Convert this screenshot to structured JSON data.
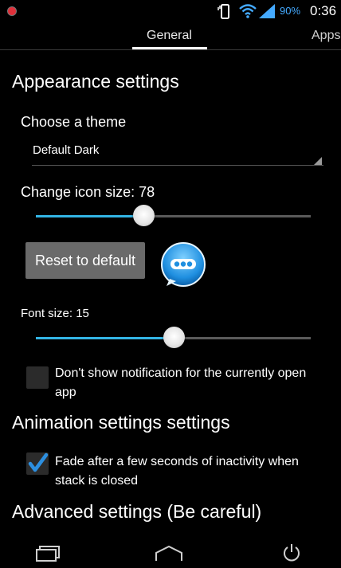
{
  "status_bar": {
    "battery_percent": "90%",
    "time": "0:36",
    "icons": [
      "record-indicator-icon",
      "phone-vibrate-icon",
      "wifi-icon",
      "signal-icon"
    ]
  },
  "tabs": [
    {
      "label": "General",
      "selected": true
    },
    {
      "label": "Apps",
      "selected": false
    }
  ],
  "appearance": {
    "title": "Appearance settings",
    "theme_label": "Choose a theme",
    "theme_value": "Default Dark",
    "icon_size_label": "Change icon size: 78",
    "icon_size_level": 0.39,
    "reset_button": "Reset to default",
    "font_size_label": "Font size: 15",
    "font_size_level": 0.5,
    "hide_notification": {
      "label": "Don't show notification for the currently open app",
      "checked": false
    }
  },
  "animation": {
    "title": "Animation settings settings",
    "fade": {
      "label": "Fade after a few seconds of inactivity when stack is closed",
      "checked": true
    }
  },
  "advanced": {
    "title": "Advanced settings (Be careful)"
  },
  "colors": {
    "accent": "#33b5e5",
    "background": "#000000",
    "check_blue": "#2c8fe0"
  },
  "nav_bar": [
    "recent-apps-icon",
    "home-icon",
    "power-icon"
  ]
}
